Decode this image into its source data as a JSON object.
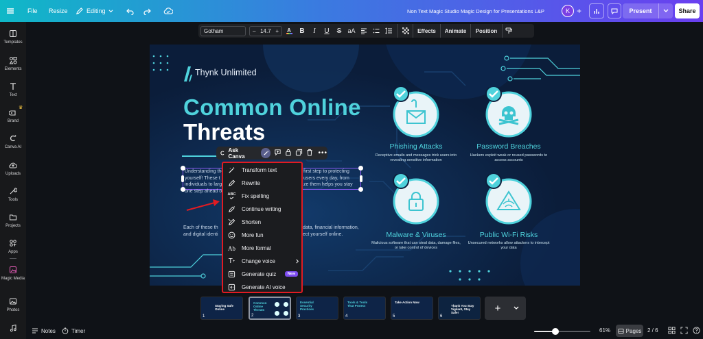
{
  "topbar": {
    "file": "File",
    "resize": "Resize",
    "editing": "Editing",
    "doc_title": "Non Text Magic Studio Magic Design for Presentations L&P",
    "avatar": "K",
    "present": "Present",
    "share": "Share"
  },
  "rail": {
    "items": [
      {
        "label": "Templates",
        "icon": "templates-icon"
      },
      {
        "label": "Elements",
        "icon": "elements-icon"
      },
      {
        "label": "Text",
        "icon": "text-icon"
      },
      {
        "label": "Brand",
        "icon": "brand-icon"
      },
      {
        "label": "Canva AI",
        "icon": "canva-ai-icon"
      },
      {
        "label": "Uploads",
        "icon": "uploads-icon"
      },
      {
        "label": "Tools",
        "icon": "tools-icon"
      },
      {
        "label": "Projects",
        "icon": "projects-icon"
      },
      {
        "label": "Apps",
        "icon": "apps-icon"
      },
      {
        "label": "Magic Media",
        "icon": "magic-media-icon"
      },
      {
        "label": "Photos",
        "icon": "photos-icon"
      }
    ]
  },
  "format_bar": {
    "font": "Gotham",
    "size": "14.7",
    "effects": "Effects",
    "animate": "Animate",
    "position": "Position"
  },
  "slide": {
    "brand": "Thynk Unlimited",
    "title_line1": "Common Online",
    "title_line2": "Threats",
    "body_line1": "Understanding the",
    "body_line1b": "first step to protecting",
    "body_line2": "yourself! These t",
    "body_line2b": "users every day, from",
    "body_line3": "individuals to larg",
    "body_line3b": "ze them helps you stay",
    "body_line4": "one step ahead o",
    "para2_line1": "Each of these th",
    "para2_line1b": "data, financial information,",
    "para2_line2": "and digital identi",
    "para2_line2b": "ect yourself online.",
    "cards": [
      {
        "title": "Phishing Attacks",
        "desc": "Deceptive emails and messages trick users into revealing sensitive information"
      },
      {
        "title": "Password Breaches",
        "desc": "Hackers exploit weak or reused passwords to access accounts"
      },
      {
        "title": "Malware & Viruses",
        "desc": "Malicious software that can steal data, damage files, or take control of devices"
      },
      {
        "title": "Public Wi-Fi Risks",
        "desc": "Unsecured networks allow attackers to intercept your data"
      }
    ],
    "accent": "#4fd2dc",
    "background": "#0b1d3a"
  },
  "context_toolbar": {
    "ask": "Ask Canva"
  },
  "magic_menu": {
    "items": [
      {
        "label": "Transform text",
        "icon": "wand-icon"
      },
      {
        "label": "Rewrite",
        "icon": "pencil-icon"
      },
      {
        "label": "Fix spelling",
        "icon": "abc-check-icon"
      },
      {
        "label": "Continue writing",
        "icon": "pen-sparkle-icon"
      },
      {
        "label": "Shorten",
        "icon": "shorten-icon"
      },
      {
        "label": "More fun",
        "icon": "smile-icon"
      },
      {
        "label": "More formal",
        "icon": "formal-ab-icon"
      },
      {
        "label": "Change voice",
        "icon": "voice-text-icon"
      },
      {
        "label": "Generate quiz",
        "icon": "quiz-icon"
      },
      {
        "label": "Generate AI voice",
        "icon": "ai-voice-icon"
      }
    ],
    "new_badge": "New",
    "highlight_color": "#e11b22"
  },
  "filmstrip": {
    "pages": [
      {
        "num": "1",
        "text": "Staying Safe Online"
      },
      {
        "num": "2",
        "text": "Common Online Threats"
      },
      {
        "num": "3",
        "text": "Essential Security Practices"
      },
      {
        "num": "4",
        "text": "Tools & Tools That Protect"
      },
      {
        "num": "5",
        "text": "Take Action Now"
      },
      {
        "num": "6",
        "text": "Thank You Stay Vigilant, Stay Safe!"
      }
    ]
  },
  "bottombar": {
    "notes": "Notes",
    "timer": "Timer",
    "zoom": "61%",
    "pages": "Pages",
    "page_count": "2 / 6",
    "zoom_level": 0.38
  }
}
